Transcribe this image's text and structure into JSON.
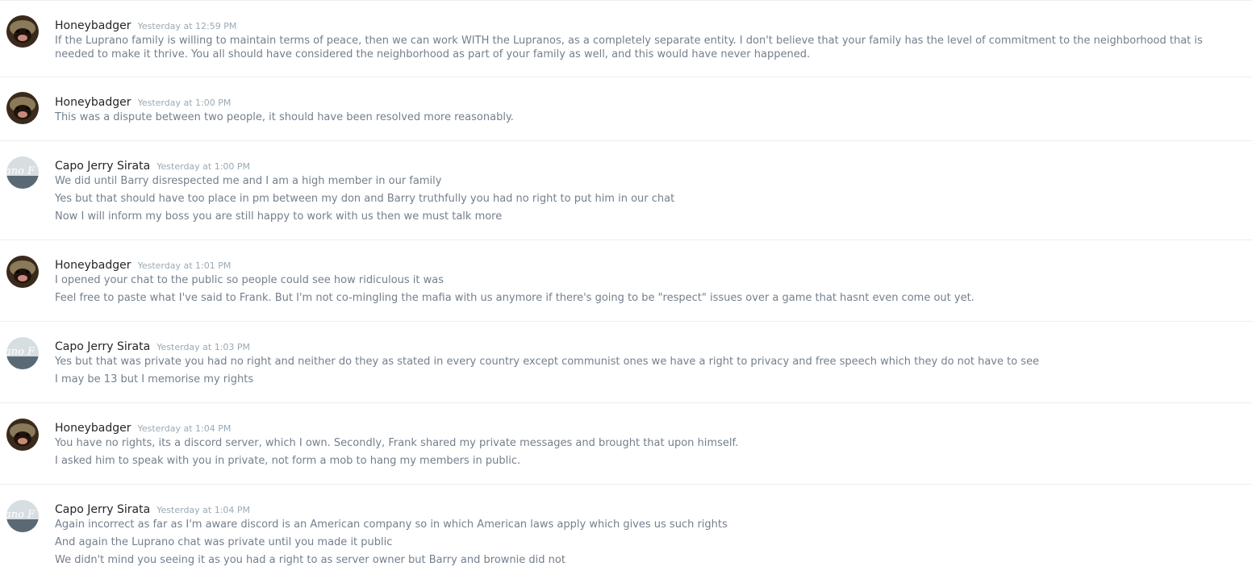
{
  "messages": [
    {
      "author": "Honeybadger",
      "avatar": "honeybadger-avatar",
      "timestamp": "Yesterday at 12:59 PM",
      "lines": [
        "If the Luprano family is willing to maintain terms of peace, then we can work WITH the Lupranos, as a completely separate entity. I don't believe that your family has the level of commitment to the neighborhood that is needed to make it thrive. You all should have considered the neighborhood as part of your family as well, and this would have never happened."
      ]
    },
    {
      "author": "Honeybadger",
      "avatar": "honeybadger-avatar",
      "timestamp": "Yesterday at 1:00 PM",
      "lines": [
        "This was a dispute between two people, it should have been resolved more reasonably."
      ]
    },
    {
      "author": "Capo Jerry Sirata",
      "avatar": "capo-avatar",
      "timestamp": "Yesterday at 1:00 PM",
      "lines": [
        "We did until Barry disrespected me and I am a high member in our family",
        "Yes but that should have too place in pm between my don and Barry truthfully you had no right to put him in our chat",
        "Now I will inform my boss you are still happy to work with us then we must talk more"
      ]
    },
    {
      "author": "Honeybadger",
      "avatar": "honeybadger-avatar",
      "timestamp": "Yesterday at 1:01 PM",
      "lines": [
        "I opened your chat to the public so people could see how ridiculous it was",
        "Feel free to paste what I've said to Frank. But I'm not co-mingling the mafia with us anymore if there's going to be \"respect\" issues over a game that hasnt even come out yet."
      ]
    },
    {
      "author": "Capo Jerry Sirata",
      "avatar": "capo-avatar",
      "timestamp": "Yesterday at 1:03 PM",
      "lines": [
        "Yes but that was private you had no right and neither do they as stated in every country except communist ones we have a right to privacy and free speech which they do not have to see",
        "I may be 13 but I memorise my rights"
      ]
    },
    {
      "author": "Honeybadger",
      "avatar": "honeybadger-avatar",
      "timestamp": "Yesterday at 1:04 PM",
      "lines": [
        "You have no rights, its a discord server, which I own. Secondly, Frank shared my private messages and brought that upon himself.",
        "I asked him to speak with you in private, not form a mob to hang my members in public."
      ]
    },
    {
      "author": "Capo Jerry Sirata",
      "avatar": "capo-avatar",
      "timestamp": "Yesterday at 1:04 PM",
      "lines": [
        "Again incorrect as far as I'm aware discord is an American company so in which American laws apply which gives us such rights",
        "And again the Luprano chat was private until you made it public",
        "We didn't mind you seeing it as you had a right to as server owner but Barry and brownie did not"
      ]
    }
  ]
}
